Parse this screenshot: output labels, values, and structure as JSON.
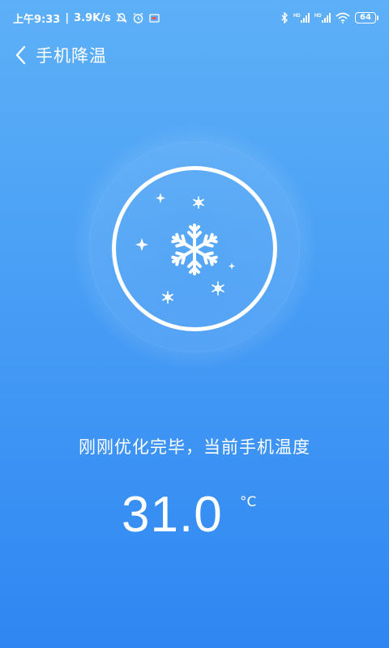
{
  "status_bar": {
    "time": "上午9:33",
    "separator": "|",
    "net_speed": "3.9K/s",
    "battery": "64",
    "icons": [
      "mute-icon",
      "alarm-icon",
      "notification-icon",
      "bluetooth-icon",
      "signal-hd-icon",
      "signal-hd-icon",
      "wifi-icon",
      "battery-icon"
    ]
  },
  "header": {
    "back_icon": "chevron-left-icon",
    "title": "手机降温"
  },
  "main": {
    "illustration": "snowflake-icon",
    "message": "刚刚优化完毕，当前手机温度",
    "temperature": "31.0",
    "unit": "°C"
  },
  "colors": {
    "background_top": "#5db0f7",
    "background_bottom": "#2f86f2",
    "foreground": "#ffffff"
  }
}
